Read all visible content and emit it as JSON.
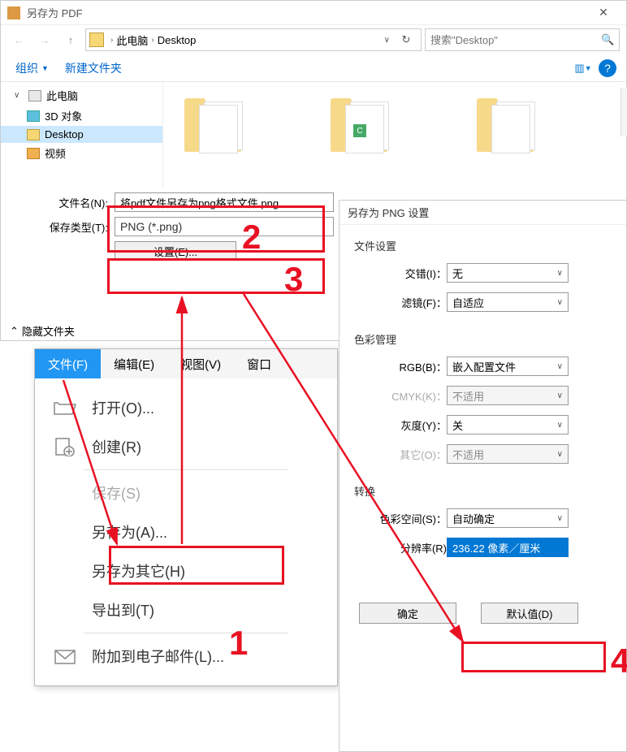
{
  "saveDialog": {
    "title": "另存为 PDF",
    "breadcrumb": {
      "level1": "此电脑",
      "level2": "Desktop"
    },
    "searchPlaceholder": "搜索\"Desktop\"",
    "toolbar": {
      "organize": "组织",
      "newFolder": "新建文件夹"
    },
    "tree": {
      "thisPC": "此电脑",
      "objects3d": "3D 对象",
      "desktop": "Desktop",
      "video": "视频"
    },
    "form": {
      "filenameLabel": "文件名(N):",
      "filenameValue": "将pdf文件另存为png格式文件.png",
      "saveTypeLabel": "保存类型(T):",
      "saveTypeValue": "PNG (*.png)",
      "settingsBtn": "设置(E)..."
    },
    "hideFolders": "隐藏文件夹"
  },
  "menu": {
    "tabs": {
      "file": "文件(F)",
      "edit": "编辑(E)",
      "view": "视图(V)",
      "window": "窗口"
    },
    "items": {
      "open": "打开(O)...",
      "create": "创建(R)",
      "save": "保存(S)",
      "saveAs": "另存为(A)...",
      "saveOther": "另存为其它(H)",
      "exportTo": "导出到(T)",
      "attachEmail": "附加到电子邮件(L)..."
    }
  },
  "pngDialog": {
    "title": "另存为 PNG 设置",
    "sections": {
      "fileSettings": "文件设置",
      "colorMgmt": "色彩管理",
      "conversion": "转换"
    },
    "fields": {
      "interlace": {
        "label": "交错(I)：",
        "value": "无"
      },
      "filter": {
        "label": "滤镜(F)：",
        "value": "自适应"
      },
      "rgb": {
        "label": "RGB(B)：",
        "value": "嵌入配置文件"
      },
      "cmyk": {
        "label": "CMYK(K)：",
        "value": "不适用"
      },
      "gray": {
        "label": "灰度(Y)：",
        "value": "关"
      },
      "other": {
        "label": "其它(O)：",
        "value": "不适用"
      },
      "colorspace": {
        "label": "色彩空间(S)：",
        "value": "自动确定"
      },
      "resolution": {
        "label": "分辨率(R)",
        "value": "236.22 像素／厘米"
      }
    },
    "buttons": {
      "ok": "确定",
      "defaults": "默认值(D)"
    }
  },
  "annotations": {
    "n1": "1",
    "n2": "2",
    "n3": "3",
    "n4": "4"
  }
}
